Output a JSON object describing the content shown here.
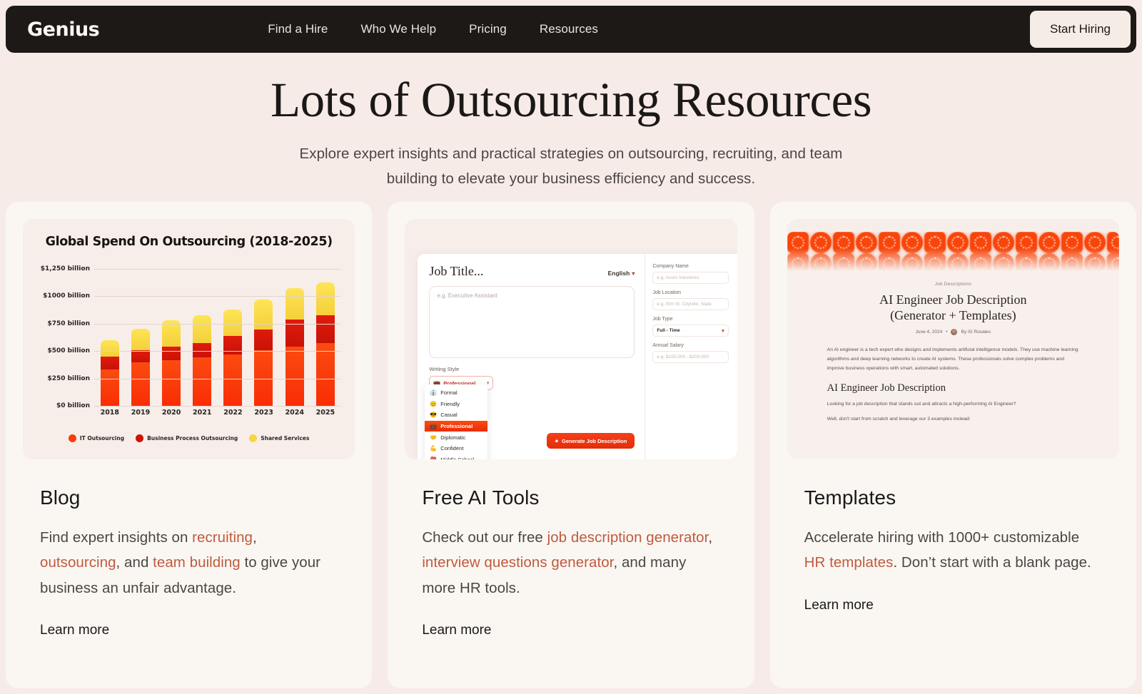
{
  "nav": {
    "brand": "Genius",
    "links": [
      {
        "label": "Find a Hire"
      },
      {
        "label": "Who We Help"
      },
      {
        "label": "Pricing"
      },
      {
        "label": "Resources"
      }
    ],
    "cta": "Start Hiring"
  },
  "hero": {
    "title": "Lots of Outsourcing Resources",
    "subtitle": "Explore expert insights and practical strategies on outsourcing, recruiting, and team building to elevate your business efficiency and success."
  },
  "chart_data": {
    "type": "bar",
    "title": "Global Spend On Outsourcing (2018-2025)",
    "xlabel": "",
    "ylabel": "",
    "ylim": [
      0,
      1250
    ],
    "grid": true,
    "stacked": true,
    "legend_position": "bottom",
    "categories": [
      "2018",
      "2019",
      "2020",
      "2021",
      "2022",
      "2023",
      "2024",
      "2025"
    ],
    "ytick_labels": [
      "$0 billion",
      "$250 billion",
      "$500 billion",
      "$750 billion",
      "$1000 billion",
      "$1,250 billion"
    ],
    "ytick_values": [
      0,
      250,
      500,
      750,
      1000,
      1250
    ],
    "series": [
      {
        "name": "IT Outsourcing",
        "color": "#fa3c0a",
        "values": [
          330,
          400,
          420,
          440,
          470,
          510,
          540,
          575
        ]
      },
      {
        "name": "Business Process Outsourcing",
        "color": "#cf1206",
        "values": [
          120,
          110,
          120,
          135,
          165,
          190,
          250,
          250
        ]
      },
      {
        "name": "Shared Services",
        "color": "#f7d63f",
        "values": [
          150,
          195,
          240,
          255,
          245,
          270,
          285,
          300
        ]
      }
    ],
    "totals": [
      600,
      705,
      780,
      830,
      880,
      970,
      1075,
      1125
    ]
  },
  "tool_mock": {
    "job_title_placeholder": "Job Title...",
    "language": "English",
    "description_placeholder": "e.g. Executive Assistant",
    "writing_style_label": "Writing Style",
    "writing_style_value": "Professional",
    "writing_style_emoji": "💼",
    "generate_button": "Generate Job Description",
    "options": [
      {
        "emoji": "👔",
        "label": "Formal"
      },
      {
        "emoji": "😊",
        "label": "Friendly"
      },
      {
        "emoji": "😎",
        "label": "Casual"
      },
      {
        "emoji": "💼",
        "label": "Professional"
      },
      {
        "emoji": "🤝",
        "label": "Diplomatic"
      },
      {
        "emoji": "💪",
        "label": "Confident"
      },
      {
        "emoji": "🎒",
        "label": "Middle School"
      }
    ],
    "fields": [
      {
        "label": "Company Name",
        "value": "e.g. Acorn Industries",
        "filled": false
      },
      {
        "label": "Job Location",
        "value": "e.g. Elm St. Cityville, State",
        "filled": false
      },
      {
        "label": "Job Type",
        "value": "Full - Time",
        "filled": true
      },
      {
        "label": "Annual Salary",
        "value": "e.g. $150,000 - $200,000",
        "filled": false
      }
    ]
  },
  "template_mock": {
    "kicker": "Job Descriptions",
    "title_line1": "AI Engineer Job Description",
    "title_line2": "(Generator + Templates)",
    "date": "June 4, 2024",
    "separator": "•",
    "author": "By IG Rosales",
    "intro": "An AI engineer is a tech expert who designs and implements artificial intelligence models. They use machine learning algorithms and deep learning networks to create AI systems. These professionals solve complex problems and improve business operations with smart, automated solutions.",
    "heading": "AI Engineer Job Description",
    "paragraph1": "Looking for a job description that stands out and attracts a high-performing AI Engineer?",
    "paragraph2": "Well, don't start from scratch and leverage our 3 examples instead:"
  },
  "cards": [
    {
      "title": "Blog",
      "text_parts": [
        {
          "t": "Find expert insights on ",
          "link": false
        },
        {
          "t": "recruiting",
          "link": true
        },
        {
          "t": ", ",
          "link": false
        },
        {
          "t": "outsourcing",
          "link": true
        },
        {
          "t": ", and ",
          "link": false
        },
        {
          "t": "team building",
          "link": true
        },
        {
          "t": " to give your business an unfair advantage.",
          "link": false
        }
      ],
      "learn_more": "Learn more"
    },
    {
      "title": "Free AI Tools",
      "text_parts": [
        {
          "t": "Check out our free ",
          "link": false
        },
        {
          "t": "job description generator",
          "link": true
        },
        {
          "t": ", ",
          "link": false
        },
        {
          "t": "interview questions generator",
          "link": true
        },
        {
          "t": ", and many more HR tools.",
          "link": false
        }
      ],
      "learn_more": "Learn more"
    },
    {
      "title": "Templates",
      "text_parts": [
        {
          "t": "Accelerate hiring with 1000+ customizable ",
          "link": false
        },
        {
          "t": "HR templates",
          "link": true
        },
        {
          "t": ". Don’t start with a blank page.",
          "link": false
        }
      ],
      "learn_more": "Learn more"
    }
  ],
  "colors": {
    "page_background": "#f7ebe8",
    "card_background": "#faf7f3",
    "media_background": "#f7eeea",
    "navbar": "#1c1917",
    "link_accent": "#c05a3e",
    "primary_orange": "#fa3c0a"
  }
}
